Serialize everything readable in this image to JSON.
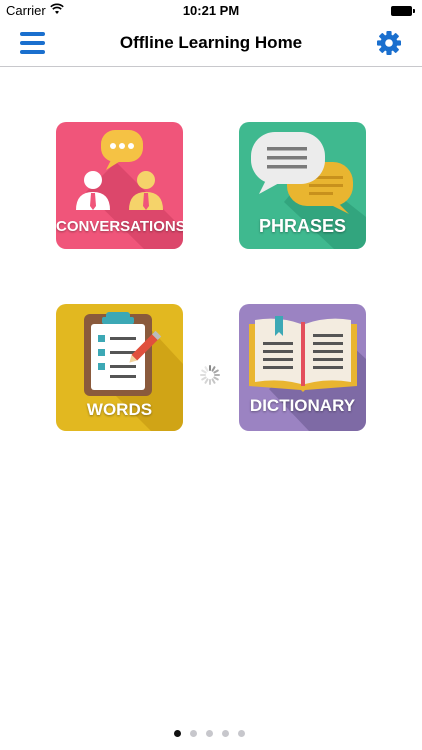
{
  "status_bar": {
    "carrier": "Carrier",
    "time": "10:21 PM"
  },
  "nav": {
    "title": "Offline Learning Home",
    "menu_icon": "hamburger-menu-icon",
    "settings_icon": "gear-icon",
    "accent_color": "#1a6fce"
  },
  "tiles": [
    {
      "label": "CONVERSATIONS",
      "color": "#f0557a",
      "icon": "two-people-chat-icon"
    },
    {
      "label": "PHRASES",
      "color": "#3fb98f",
      "icon": "speech-bubbles-icon"
    },
    {
      "label": "WORDS",
      "color": "#e2b820",
      "icon": "clipboard-checklist-icon"
    },
    {
      "label": "DICTIONARY",
      "color": "#9b83c2",
      "icon": "open-book-icon"
    }
  ],
  "loading_indicator": "spinner-icon",
  "pagination": {
    "total_pages": 5,
    "current_page": 1
  }
}
